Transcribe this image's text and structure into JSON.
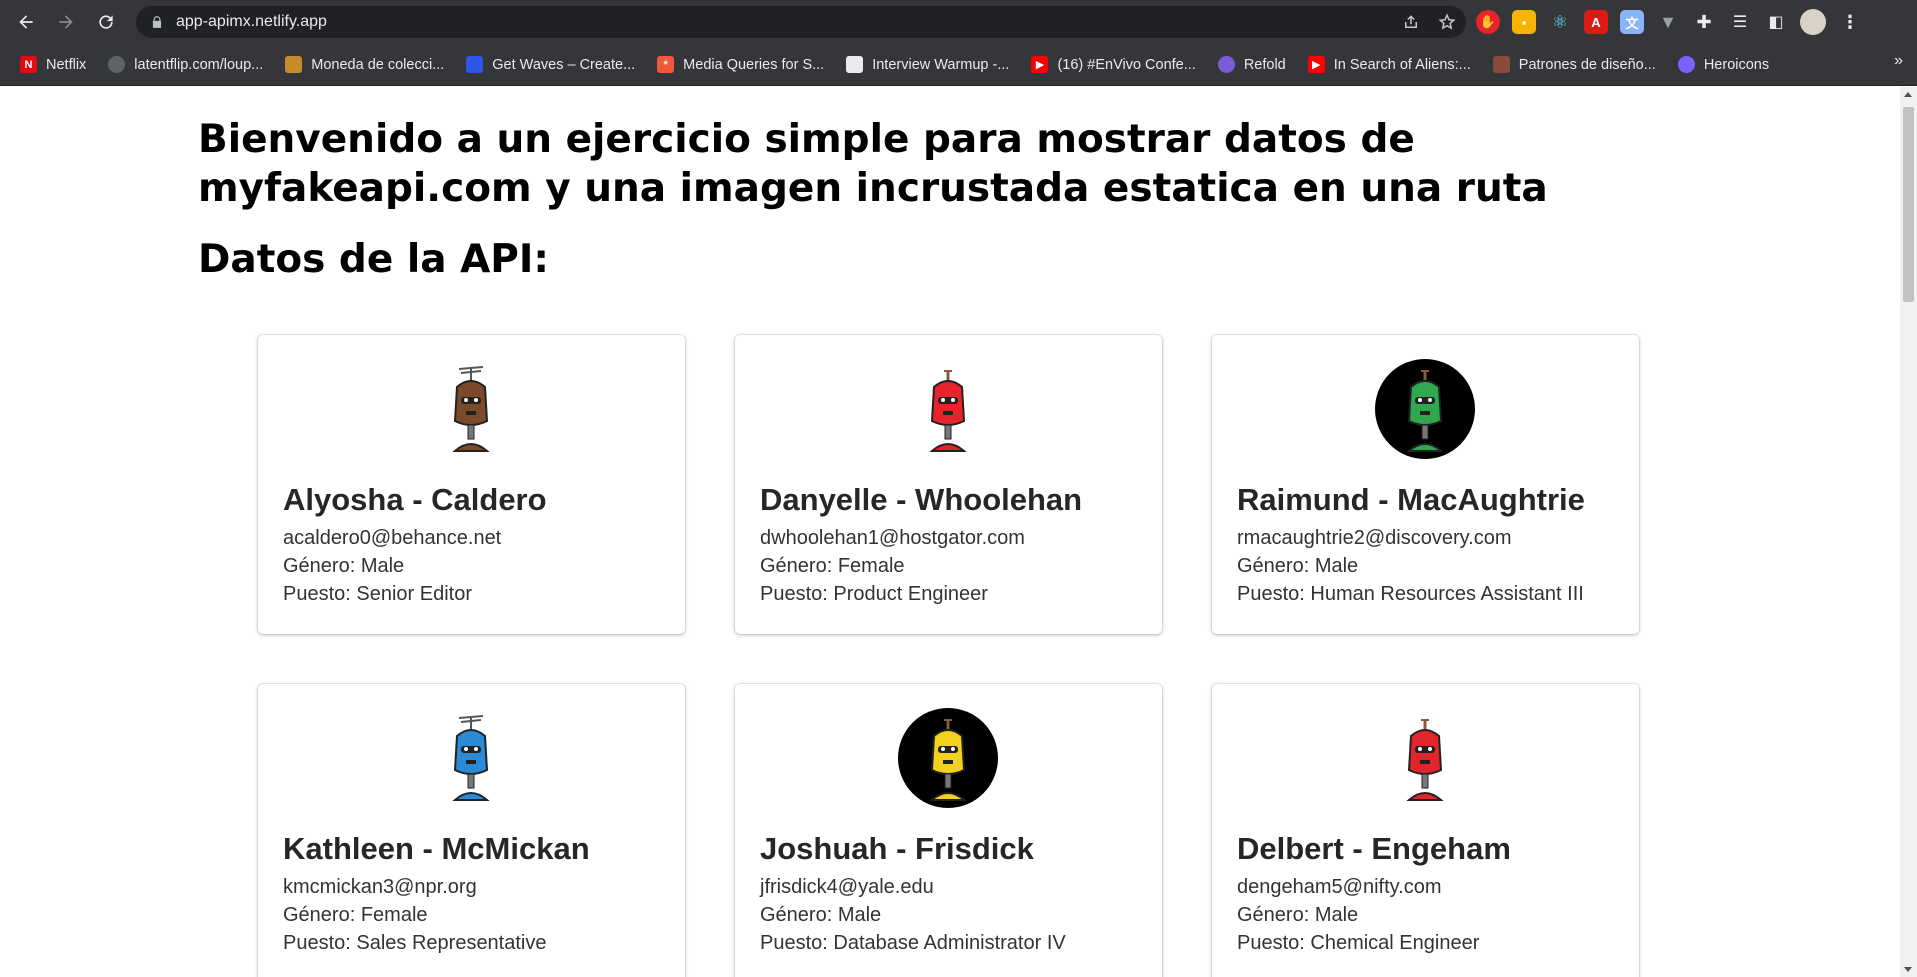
{
  "browser": {
    "url": "app-apimx.netlify.app",
    "bookmarks": [
      {
        "label": "Netflix",
        "icon": "netflix-icon",
        "color": "#e50914",
        "glyph": "N"
      },
      {
        "label": "latentflip.com/loup...",
        "icon": "globe-icon",
        "color": "#5f6368",
        "glyph": ""
      },
      {
        "label": "Moneda de colecci...",
        "icon": "coin-icon",
        "color": "#c58b2a",
        "glyph": ""
      },
      {
        "label": "Get Waves – Create...",
        "icon": "waves-icon",
        "color": "#2d55e8",
        "glyph": ""
      },
      {
        "label": "Media Queries for S...",
        "icon": "asterisk-icon",
        "color": "#ef5b3a",
        "glyph": "*"
      },
      {
        "label": "Interview Warmup -...",
        "icon": "doc-icon",
        "color": "#e8eaed",
        "glyph": ""
      },
      {
        "label": "(16) #EnVivo Confe...",
        "icon": "youtube-icon",
        "color": "#ff0000",
        "glyph": "▶"
      },
      {
        "label": "Refold",
        "icon": "refold-icon",
        "color": "#7b5cd6",
        "glyph": ""
      },
      {
        "label": "In Search of Aliens:...",
        "icon": "youtube-icon",
        "color": "#ff0000",
        "glyph": "▶"
      },
      {
        "label": "Patrones de diseño...",
        "icon": "raccoon-icon",
        "color": "#8a4b3a",
        "glyph": ""
      },
      {
        "label": "Heroicons",
        "icon": "shield-icon",
        "color": "#7b61ff",
        "glyph": ""
      }
    ],
    "bookmarks_more": "»"
  },
  "page": {
    "title": "Bienvenido a un ejercicio simple para mostrar datos de myfakeapi.com y una imagen incrustada estatica en una ruta",
    "subtitle": "Datos de la API:"
  },
  "users": [
    {
      "name": "Alyosha - Caldero",
      "email": "acaldero0@behance.net",
      "gender": "Género: Male",
      "job": "Puesto: Senior Editor",
      "avatar": {
        "body": "#7a4a2a",
        "bg": "#ffffff",
        "icon": "robot-brown-icon"
      }
    },
    {
      "name": "Danyelle - Whoolehan",
      "email": "dwhoolehan1@hostgator.com",
      "gender": "Género: Female",
      "job": "Puesto: Product Engineer",
      "avatar": {
        "body": "#e8232b",
        "bg": "#ffffff",
        "icon": "robot-red-icon"
      }
    },
    {
      "name": "Raimund - MacAughtrie",
      "email": "rmacaughtrie2@discovery.com",
      "gender": "Género: Male",
      "job": "Puesto: Human Resources Assistant III",
      "avatar": {
        "body": "#2fa84f",
        "bg": "#000000",
        "icon": "robot-green-icon"
      }
    },
    {
      "name": "Kathleen - McMickan",
      "email": "kmcmickan3@npr.org",
      "gender": "Género: Female",
      "job": "Puesto: Sales Representative",
      "avatar": {
        "body": "#2b8ad6",
        "bg": "#ffffff",
        "icon": "robot-blue-icon"
      }
    },
    {
      "name": "Joshuah - Frisdick",
      "email": "jfrisdick4@yale.edu",
      "gender": "Género: Male",
      "job": "Puesto: Database Administrator IV",
      "avatar": {
        "body": "#f2d21d",
        "bg": "#000000",
        "icon": "robot-yellow-icon"
      }
    },
    {
      "name": "Delbert - Engeham",
      "email": "dengeham5@nifty.com",
      "gender": "Género: Male",
      "job": "Puesto: Chemical Engineer",
      "avatar": {
        "body": "#e0262c",
        "bg": "#ffffff",
        "icon": "robot-red-antenna-icon"
      }
    }
  ]
}
